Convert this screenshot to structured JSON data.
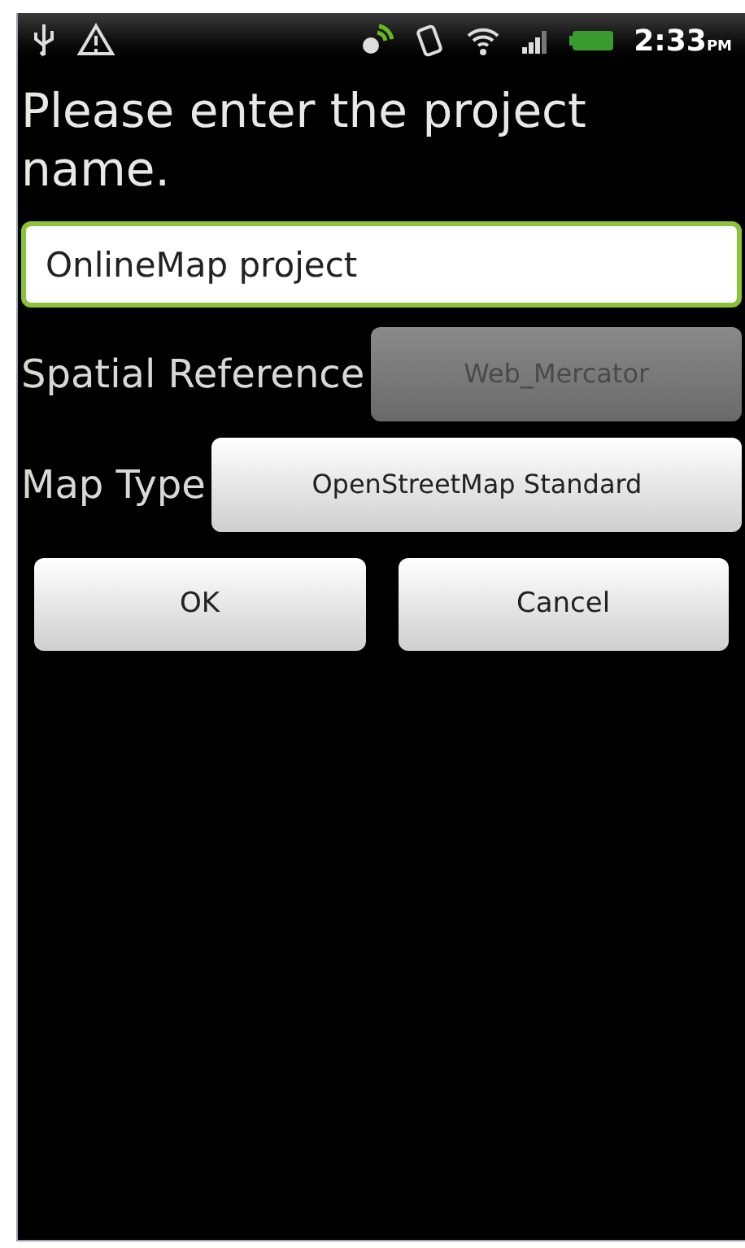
{
  "status_bar": {
    "time": "2:33",
    "time_suffix": "PM"
  },
  "prompt": "Please enter the project name.",
  "project_name": {
    "value": "OnlineMap project",
    "focused": true
  },
  "fields": [
    {
      "label": "Spatial Reference",
      "value": "Web_Mercator",
      "disabled": true
    },
    {
      "label": "Map Type",
      "value": "OpenStreetMap Standard",
      "disabled": false
    }
  ],
  "buttons": [
    "OK",
    "Cancel"
  ]
}
